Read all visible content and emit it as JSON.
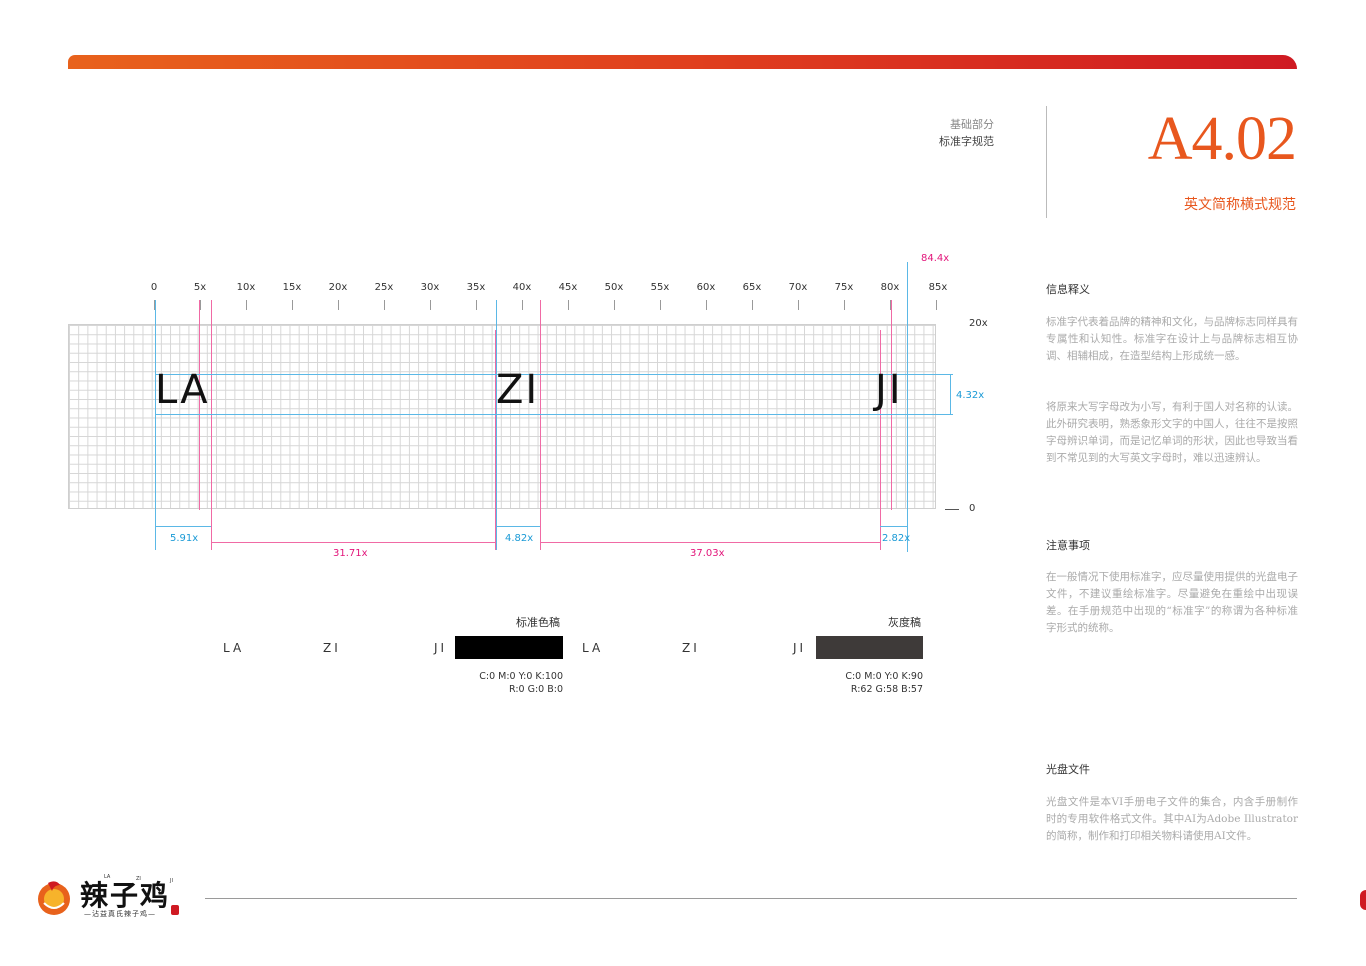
{
  "header": {
    "category": "基础部分",
    "subcategory": "标准字规范",
    "page_code": "A4.02",
    "page_title": "英文简称横式规范"
  },
  "sidebar": {
    "sections": [
      {
        "heading": "信息释义",
        "paragraphs": [
          "标准字代表着品牌的精神和文化，与品牌标志同样具有专属性和认知性。标准字在设计上与品牌标志相互协调、相辅相成，在造型结构上形成统一感。",
          "将原来大写字母改为小写，有利于国人对名称的认读。此外研究表明，熟悉象形文字的中国人，往往不是按照字母辨识单词，而是记忆单词的形状，因此也导致当看到不常见到的大写英文字母时，难以迅速辨认。"
        ]
      },
      {
        "heading": "注意事项",
        "paragraphs": [
          "在一般情况下使用标准字，应尽量使用提供的光盘电子文件，不建议重绘标准字。尽量避免在重绘中出现误差。在手册规范中出现的“标准字”的称谓为各种标准字形式的统称。"
        ]
      },
      {
        "heading": "光盘文件",
        "paragraphs": [
          "光盘文件是本VI手册电子文件的集合，内含手册制作时的专用软件格式文件。其中AI为Adobe Illustrator的简称，制作和打印相关物料请使用AI文件。"
        ]
      }
    ]
  },
  "grid_diagram": {
    "x_ticks": [
      "0",
      "5x",
      "10x",
      "15x",
      "20x",
      "25x",
      "30x",
      "35x",
      "40x",
      "45x",
      "50x",
      "55x",
      "60x",
      "65x",
      "70x",
      "75x",
      "80x",
      "85x"
    ],
    "max_marker": "84.4x",
    "y_top": "20x",
    "y_bottom": "0",
    "height_label": "4.32x",
    "words": [
      "LA",
      "ZI",
      "JI"
    ],
    "dimensions": {
      "left_margin": "5.91x",
      "gap_1": "31.71x",
      "width_zi": "4.82x",
      "gap_2": "37.03x",
      "width_ji": "2.82x"
    },
    "colors": {
      "blue": "#1a9ad6",
      "pink": "#e2157a"
    }
  },
  "swatches": [
    {
      "label": "标准色稿",
      "words": [
        "LA",
        "ZI",
        "JI"
      ],
      "color": "#000000",
      "cmyk": "C:0  M:0  Y:0  K:100",
      "rgb": "R:0  G:0  B:0"
    },
    {
      "label": "灰度稿",
      "words": [
        "LA",
        "ZI",
        "JI"
      ],
      "color": "#3e3a39",
      "cmyk": "C:0  M:0  Y:0  K:90",
      "rgb": "R:62  G:58  B:57"
    }
  ],
  "footer": {
    "logo_name": "辣子鸡",
    "logo_letters": [
      "LA",
      "ZI",
      "JI"
    ],
    "logo_sub": "—沾益真氏辣子鸡—",
    "logo_icon": "chili-chicken-logo-icon"
  },
  "brand_colors": {
    "orange": "#e8571e",
    "red": "#cf1a22"
  }
}
